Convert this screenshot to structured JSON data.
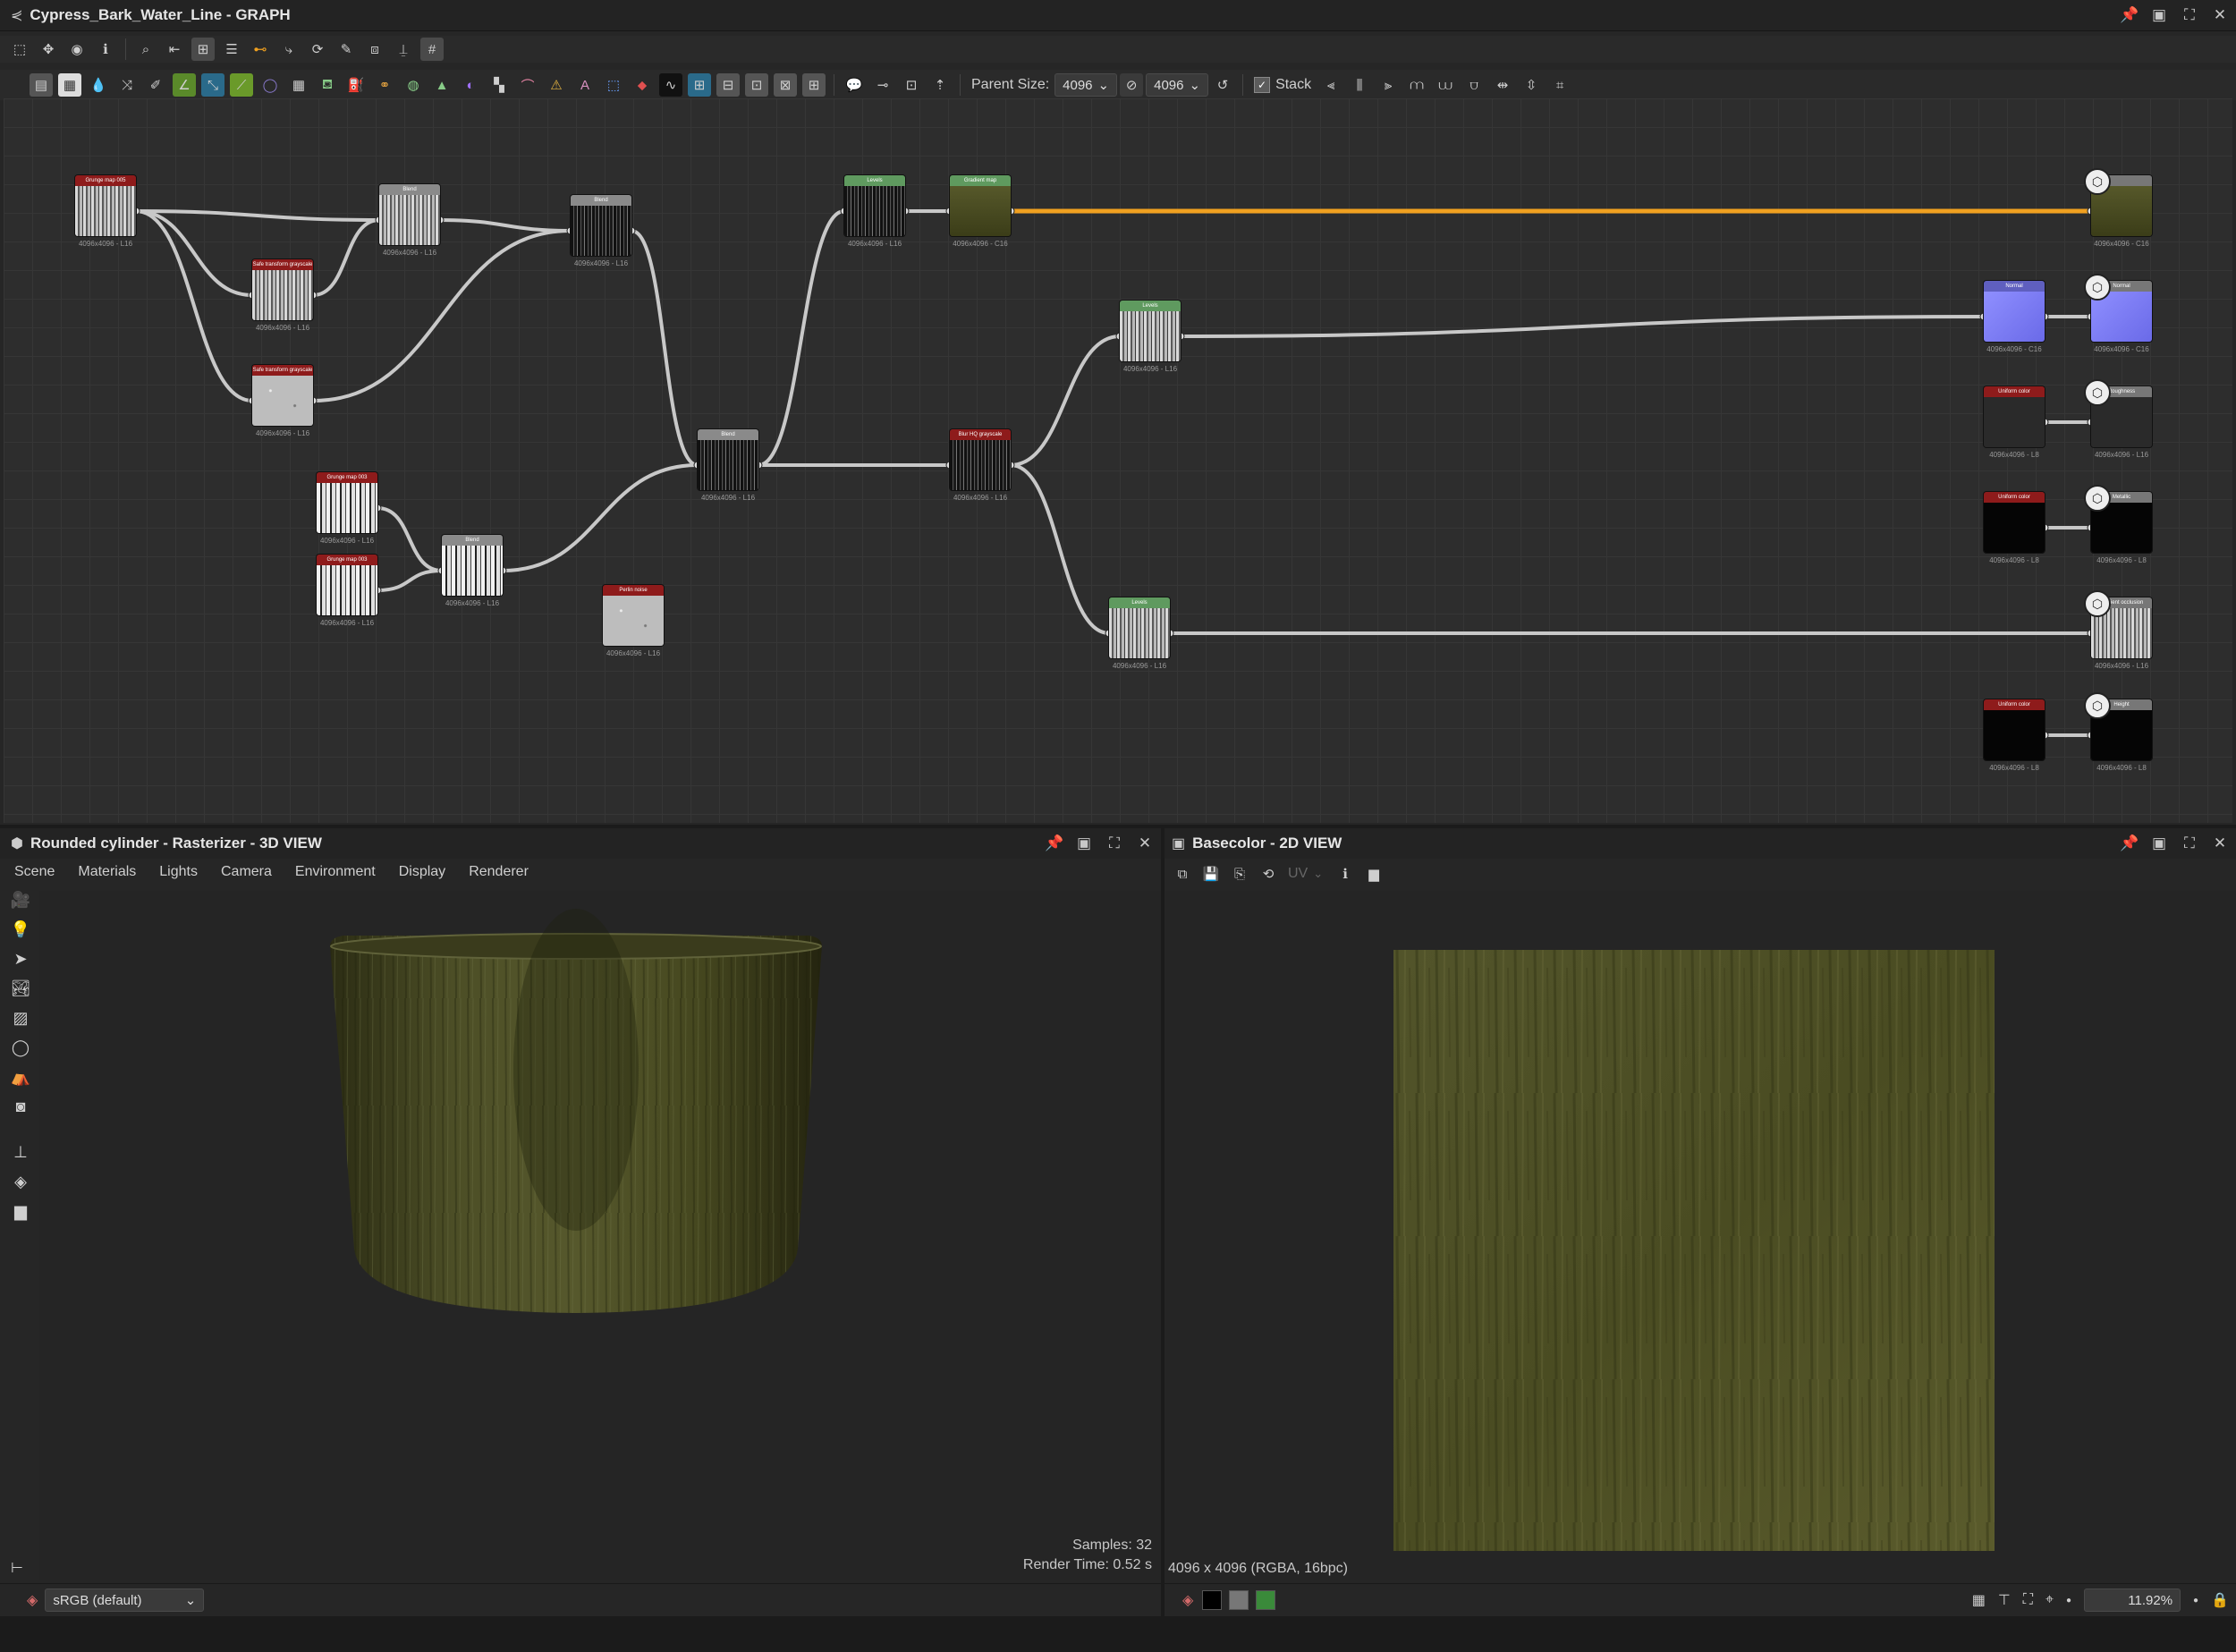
{
  "graph_panel": {
    "title": "Cypress_Bark_Water_Line - GRAPH",
    "icon": "graph-icon",
    "window_controls": [
      "pin-icon",
      "restore-icon",
      "maximize-icon",
      "close-icon"
    ],
    "toolbar1_icons": [
      "frame-icon",
      "move-icon",
      "camera-icon",
      "info-icon",
      "search-icon",
      "align-icon",
      "hierarchy-icon",
      "list-icon",
      "connect-icon",
      "link-icon",
      "rotate-icon",
      "tool-icon",
      "frame-snap-icon",
      "stamp-icon",
      "grid-icon"
    ],
    "toolbar2": {
      "parent_size_label": "Parent Size:",
      "parent_size_value": "4096",
      "size_value_2": "4096",
      "stack_label": "Stack"
    }
  },
  "graph": {
    "nodes": [
      {
        "id": "n1",
        "header": "Grunge map 005",
        "caption": "4096x4096 - L16",
        "hdr_color": "#8e1b1b",
        "tex": "wood"
      },
      {
        "id": "n2",
        "header": "Safe transform grayscale",
        "caption": "4096x4096 - L16",
        "hdr_color": "#8e1b1b",
        "tex": "wood"
      },
      {
        "id": "n3",
        "header": "Safe transform grayscale",
        "caption": "4096x4096 - L16",
        "hdr_color": "#8e1b1b",
        "tex": "noise"
      },
      {
        "id": "n4",
        "header": "Blend",
        "caption": "4096x4096 - L16",
        "hdr_color": "#8a8a8a",
        "tex": "wood"
      },
      {
        "id": "n5",
        "header": "Blend",
        "caption": "4096x4096 - L16",
        "hdr_color": "#8a8a8a",
        "tex": "dark"
      },
      {
        "id": "n6",
        "header": "Grunge map 003",
        "caption": "4096x4096 - L16",
        "hdr_color": "#8e1b1b",
        "tex": "bright"
      },
      {
        "id": "n7",
        "header": "Grunge map 003",
        "caption": "4096x4096 - L16",
        "hdr_color": "#8e1b1b",
        "tex": "bright"
      },
      {
        "id": "n8",
        "header": "Blend",
        "caption": "4096x4096 - L16",
        "hdr_color": "#8a8a8a",
        "tex": "bright"
      },
      {
        "id": "n9",
        "header": "Perlin noise",
        "caption": "4096x4096 - L16",
        "hdr_color": "#8e1b1b",
        "tex": "noise"
      },
      {
        "id": "n10",
        "header": "Blend",
        "caption": "4096x4096 - L16",
        "hdr_color": "#8a8a8a",
        "tex": "dark"
      },
      {
        "id": "n11",
        "header": "Levels",
        "caption": "4096x4096 - L16",
        "hdr_color": "#5f9a5f",
        "tex": "dark"
      },
      {
        "id": "n12",
        "header": "Gradient map",
        "caption": "4096x4096 - C16",
        "hdr_color": "#5f9a5f",
        "tex": "olive"
      },
      {
        "id": "n13",
        "header": "Blur HQ grayscale",
        "caption": "4096x4096 - L16",
        "hdr_color": "#8e1b1b",
        "tex": "dark"
      },
      {
        "id": "n14",
        "header": "Levels",
        "caption": "4096x4096 - L16",
        "hdr_color": "#5f9a5f",
        "tex": "wood"
      },
      {
        "id": "n15",
        "header": "Levels",
        "caption": "4096x4096 - L16",
        "hdr_color": "#5f9a5f",
        "tex": "wood"
      },
      {
        "id": "n16",
        "header": "Normal",
        "caption": "4096x4096 - C16",
        "hdr_color": "#5f5fbf",
        "tex": "normal"
      },
      {
        "id": "n17",
        "header": "Uniform color",
        "caption": "4096x4096 - L8",
        "hdr_color": "#8e1b1b",
        "tex": "gray"
      },
      {
        "id": "n18",
        "header": "Uniform color",
        "caption": "4096x4096 - L8",
        "hdr_color": "#8e1b1b",
        "tex": "black"
      },
      {
        "id": "n19",
        "header": "Uniform color",
        "caption": "4096x4096 - L8",
        "hdr_color": "#8e1b1b",
        "tex": "black"
      },
      {
        "id": "o1",
        "header": "",
        "caption": "4096x4096 - C16",
        "hdr_color": "#777777",
        "tex": "olive"
      },
      {
        "id": "o2",
        "header": "Normal",
        "caption": "4096x4096 - C16",
        "hdr_color": "#777777",
        "tex": "normal"
      },
      {
        "id": "o3",
        "header": "Roughness",
        "caption": "4096x4096 - L16",
        "hdr_color": "#777777",
        "tex": "gray"
      },
      {
        "id": "o4",
        "header": "Metallic",
        "caption": "4096x4096 - L8",
        "hdr_color": "#777777",
        "tex": "black"
      },
      {
        "id": "o5",
        "header": "Ambient occlusion",
        "caption": "4096x4096 - L16",
        "hdr_color": "#777777",
        "tex": "wood"
      },
      {
        "id": "o6",
        "header": "Height",
        "caption": "4096x4096 - L8",
        "hdr_color": "#777777",
        "tex": "black"
      }
    ]
  },
  "view3d": {
    "title": "Rounded cylinder - Rasterizer - 3D VIEW",
    "icon": "cube-icon",
    "menu": [
      "Scene",
      "Materials",
      "Lights",
      "Camera",
      "Environment",
      "Display",
      "Renderer"
    ],
    "samples": "Samples: 32",
    "render_time": "Render Time: 0.52 s",
    "colorspace": "sRGB (default)"
  },
  "view2d": {
    "title": "Basecolor - 2D VIEW",
    "icon": "image-icon",
    "uv_label": "UV",
    "resolution_info": "4096 x 4096 (RGBA, 16bpc)",
    "zoom": "11.92%"
  },
  "colors": {
    "accent_orange": "#f0a020",
    "wire": "#c8c8c8",
    "panel_bg": "#262626",
    "graph_bg": "#2d2d2d"
  }
}
